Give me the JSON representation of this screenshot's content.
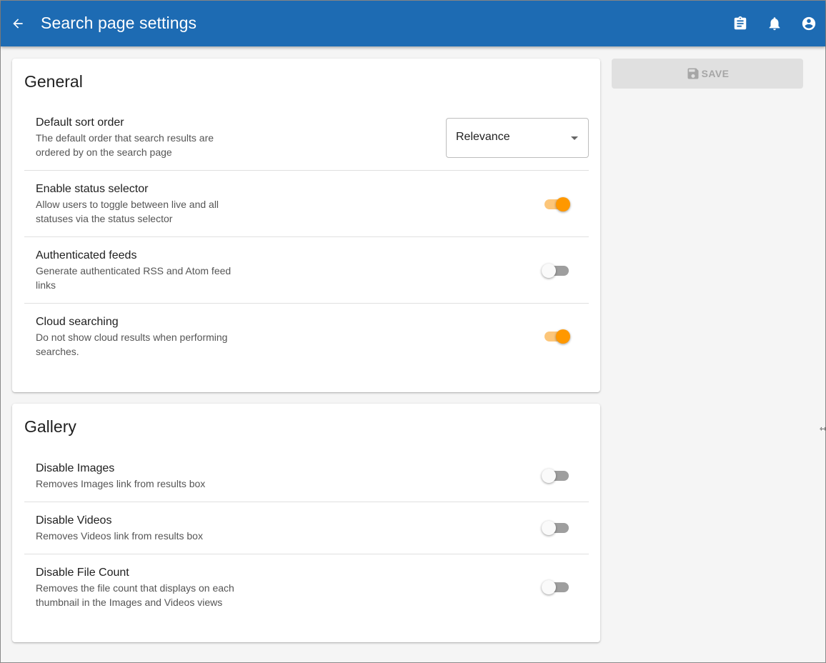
{
  "appbar": {
    "title": "Search page settings",
    "icons": [
      "arrow-back-icon",
      "clipboard-icon",
      "bell-icon",
      "account-icon"
    ],
    "color": "#1d6bb3"
  },
  "general": {
    "title": "General",
    "sort_order": {
      "label": "Default sort order",
      "description": "The default order that search results are ordered by on the search page",
      "value": "Relevance"
    },
    "status_selector": {
      "label": "Enable status selector",
      "description": "Allow users to toggle between live and all statuses via the status selector",
      "enabled": true
    },
    "authenticated_feeds": {
      "label": "Authenticated feeds",
      "description": "Generate authenticated RSS and Atom feed links",
      "enabled": false
    },
    "cloud_searching": {
      "label": "Cloud searching",
      "description": "Do not show cloud results when performing searches.",
      "enabled": true
    }
  },
  "gallery": {
    "title": "Gallery",
    "disable_images": {
      "label": "Disable Images",
      "description": "Removes Images link from results box",
      "enabled": false
    },
    "disable_videos": {
      "label": "Disable Videos",
      "description": "Removes Videos link from results box",
      "enabled": false
    },
    "disable_file_count": {
      "label": "Disable File Count",
      "description": "Removes the file count that displays on each thumbnail in the Images and Videos views",
      "enabled": false
    }
  },
  "save_button": {
    "label": "SAVE",
    "disabled": true,
    "icon": "save-icon"
  },
  "colors": {
    "accent": "#ff9800",
    "accent_track": "#fcc67a",
    "appbar": "#1d6bb3"
  }
}
